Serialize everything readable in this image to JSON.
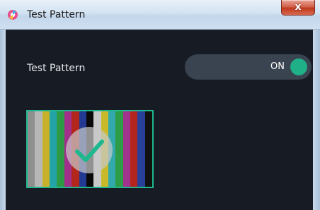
{
  "window": {
    "title": "Test Pattern",
    "close_label": "x"
  },
  "settings": {
    "test_pattern_label": "Test Pattern",
    "toggle_state": "ON",
    "toggle_on": true
  },
  "thumbnail": {
    "selected": true,
    "bar_colors": [
      "#8f8f8f",
      "#b7b7b7",
      "#c7b12a",
      "#25a4a8",
      "#2f9a45",
      "#a0308a",
      "#b3261c",
      "#233a93",
      "#0a0a0a",
      "#c9c9c9",
      "#c9ba2c",
      "#34a9ab",
      "#2e9b47",
      "#a2338d",
      "#b42520",
      "#28409a",
      "#111111"
    ]
  },
  "colors": {
    "accent": "#1fb088",
    "background": "#171b24",
    "toggle_track": "#3a4350"
  }
}
